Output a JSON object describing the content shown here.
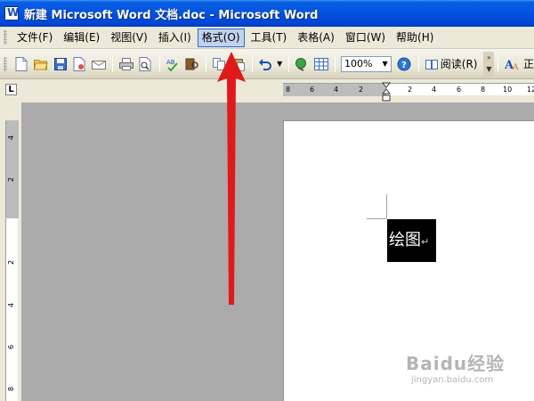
{
  "window": {
    "title": "新建 Microsoft Word 文档.doc - Microsoft Word"
  },
  "menubar": {
    "items": [
      {
        "label": "文件(F)"
      },
      {
        "label": "编辑(E)"
      },
      {
        "label": "视图(V)"
      },
      {
        "label": "插入(I)"
      },
      {
        "label": "格式(O)",
        "active": true
      },
      {
        "label": "工具(T)"
      },
      {
        "label": "表格(A)"
      },
      {
        "label": "窗口(W)"
      },
      {
        "label": "帮助(H)"
      }
    ]
  },
  "toolbar": {
    "zoom": "100%",
    "read_label": "阅读(R)",
    "style_label": "正"
  },
  "ruler": {
    "horizontal_ticks": [
      "8",
      "6",
      "4",
      "2",
      "2",
      "4",
      "6",
      "8",
      "10",
      "12"
    ],
    "vertical_ticks": [
      "4",
      "2",
      "2",
      "4",
      "6",
      "8"
    ]
  },
  "document": {
    "selected_text": "绘图"
  },
  "watermark": {
    "logo": "Baidu经验",
    "url": "jingyan.baidu.com"
  },
  "colors": {
    "title_bar": "#0055E5",
    "menu_bg": "#ECE9D8",
    "workspace": "#ABABAB",
    "highlight": "#C1D2EE",
    "arrow": "#E01A1A"
  }
}
